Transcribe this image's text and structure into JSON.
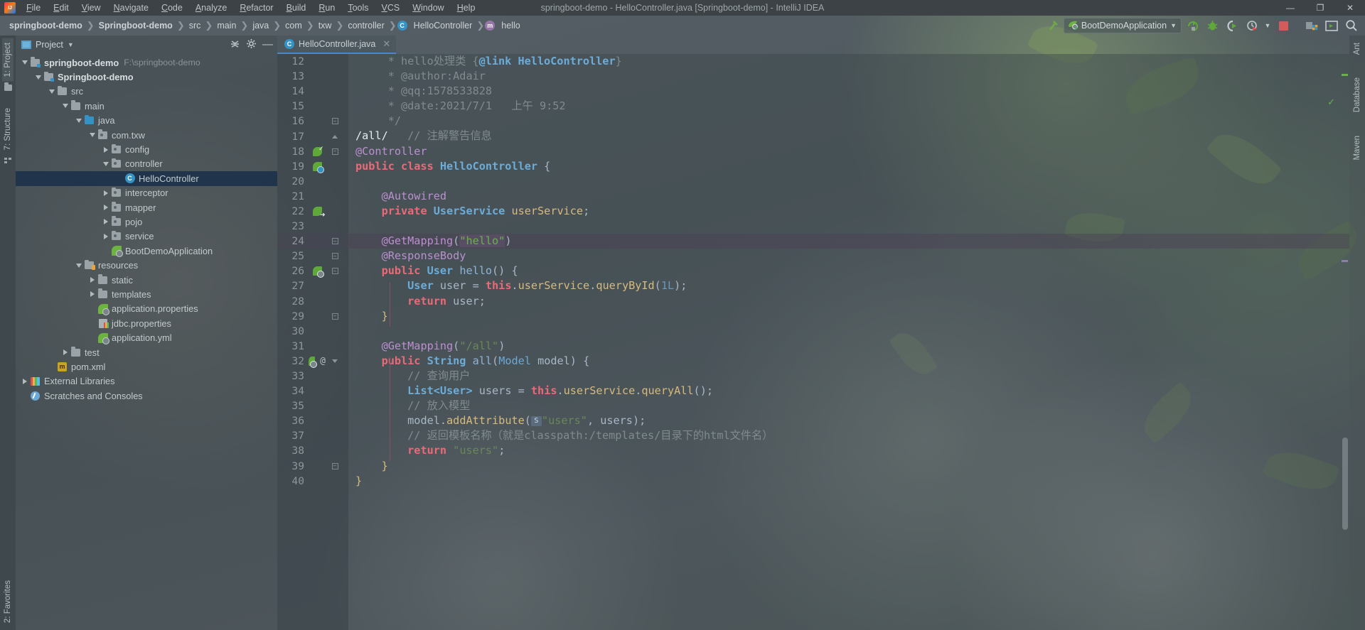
{
  "window": {
    "title": "springboot-demo - HelloController.java [Springboot-demo] - IntelliJ IDEA",
    "logo_icon": "intellij-idea-logo",
    "minimize_label": "—",
    "maximize_label": "❐",
    "close_label": "✕"
  },
  "menu": [
    {
      "label": "File"
    },
    {
      "label": "Edit"
    },
    {
      "label": "View"
    },
    {
      "label": "Navigate"
    },
    {
      "label": "Code"
    },
    {
      "label": "Analyze"
    },
    {
      "label": "Refactor"
    },
    {
      "label": "Build"
    },
    {
      "label": "Run"
    },
    {
      "label": "Tools"
    },
    {
      "label": "VCS"
    },
    {
      "label": "Window"
    },
    {
      "label": "Help"
    }
  ],
  "breadcrumb": [
    {
      "label": "springboot-demo",
      "bold": true
    },
    {
      "label": "Springboot-demo",
      "bold": true
    },
    {
      "label": "src"
    },
    {
      "label": "main"
    },
    {
      "label": "java"
    },
    {
      "label": "com"
    },
    {
      "label": "txw"
    },
    {
      "label": "controller"
    },
    {
      "label": "HelloController",
      "badge": "C"
    },
    {
      "label": "hello",
      "badge": "m"
    }
  ],
  "toolbar": {
    "run_config_name": "BootDemoApplication",
    "run_config_icon": "spring-boot-icon",
    "dropdown_icon": "chevron-down-icon",
    "build_icon": "build-hammer-icon",
    "icons": [
      {
        "name": "rerun-icon",
        "glyph": "↻"
      },
      {
        "name": "debug-icon",
        "glyph": "🐞"
      },
      {
        "name": "run-with-coverage-icon",
        "glyph": "▶"
      },
      {
        "name": "profiler-icon",
        "glyph": "⏱"
      },
      {
        "name": "profiler-dropdown-icon",
        "glyph": "▾"
      },
      {
        "name": "stop-icon",
        "glyph": "■"
      },
      {
        "name": "project-structure-icon",
        "glyph": "▤"
      },
      {
        "name": "terminal-icon",
        "glyph": "▶"
      },
      {
        "name": "search-everywhere-icon",
        "glyph": "🔍"
      }
    ]
  },
  "left_strip": {
    "project_tab": "1: Project",
    "structure_tab": "7: Structure",
    "favorites_tab": "2: Favorites"
  },
  "right_strip": {
    "ant_tab": "Ant",
    "database_tab": "Database",
    "maven_tab": "Maven"
  },
  "project_panel": {
    "title": "Project",
    "title_dropdown_icon": "chevron-down-icon",
    "collapse_all_icon": "collapse-all-icon",
    "settings_icon": "gear-icon",
    "hide_icon": "minimize-icon",
    "tree": [
      {
        "label": "springboot-demo",
        "path": "F:\\springboot-demo",
        "depth": 0,
        "twisty": "down",
        "icon": "module-folder",
        "bold": true
      },
      {
        "label": "Springboot-demo",
        "depth": 1,
        "twisty": "down",
        "icon": "module-folder",
        "bold": true
      },
      {
        "label": "src",
        "depth": 2,
        "twisty": "down",
        "icon": "folder"
      },
      {
        "label": "main",
        "depth": 3,
        "twisty": "down",
        "icon": "folder"
      },
      {
        "label": "java",
        "depth": 4,
        "twisty": "down",
        "icon": "source-folder"
      },
      {
        "label": "com.txw",
        "depth": 5,
        "twisty": "down",
        "icon": "package"
      },
      {
        "label": "config",
        "depth": 6,
        "twisty": "right",
        "icon": "package"
      },
      {
        "label": "controller",
        "depth": 6,
        "twisty": "down",
        "icon": "package"
      },
      {
        "label": "HelloController",
        "depth": 7,
        "twisty": "none",
        "icon": "java-class",
        "selected": true
      },
      {
        "label": "interceptor",
        "depth": 6,
        "twisty": "right",
        "icon": "package"
      },
      {
        "label": "mapper",
        "depth": 6,
        "twisty": "right",
        "icon": "package"
      },
      {
        "label": "pojo",
        "depth": 6,
        "twisty": "right",
        "icon": "package"
      },
      {
        "label": "service",
        "depth": 6,
        "twisty": "right",
        "icon": "package"
      },
      {
        "label": "BootDemoApplication",
        "depth": 6,
        "twisty": "none",
        "icon": "spring-boot-class"
      },
      {
        "label": "resources",
        "depth": 4,
        "twisty": "down",
        "icon": "resources-folder"
      },
      {
        "label": "static",
        "depth": 5,
        "twisty": "right",
        "icon": "folder"
      },
      {
        "label": "templates",
        "depth": 5,
        "twisty": "right",
        "icon": "folder"
      },
      {
        "label": "application.properties",
        "depth": 5,
        "twisty": "none",
        "icon": "spring-config"
      },
      {
        "label": "jdbc.properties",
        "depth": 5,
        "twisty": "none",
        "icon": "properties-file"
      },
      {
        "label": "application.yml",
        "depth": 5,
        "twisty": "none",
        "icon": "spring-config"
      },
      {
        "label": "test",
        "depth": 3,
        "twisty": "right",
        "icon": "folder"
      },
      {
        "label": "pom.xml",
        "depth": 2,
        "twisty": "none",
        "icon": "maven-file"
      },
      {
        "label": "External Libraries",
        "depth": 0,
        "twisty": "right",
        "icon": "libraries"
      },
      {
        "label": "Scratches and Consoles",
        "depth": 0,
        "twisty": "none",
        "icon": "scratches"
      }
    ]
  },
  "editor": {
    "tab": {
      "label": "HelloController.java",
      "icon": "java-class",
      "close_icon": "close-icon"
    },
    "inspection_status_icon": "inspection-ok-icon",
    "first_line": 12,
    "lines": [
      {
        "n": 12,
        "gutter": "",
        "fold": "",
        "html": "<span class='cmt'>     * hello处理类 {</span><span class='cls-blue'>@link HelloController</span><span class='cmt'>}</span>"
      },
      {
        "n": 13,
        "gutter": "",
        "fold": "",
        "html": "<span class='cmt'>     * @author:Adair</span>"
      },
      {
        "n": 14,
        "gutter": "",
        "fold": "",
        "html": "<span class='cmt'>     * @qq:1578533828</span>"
      },
      {
        "n": 15,
        "gutter": "",
        "fold": "",
        "html": "<span class='cmt'>     * @date:2021/7/1</span><span class='cmt'>   上午 9:52</span>"
      },
      {
        "n": 16,
        "gutter": "",
        "fold": "fold-end",
        "html": "<span class='cmt'>     */</span>"
      },
      {
        "n": 17,
        "gutter": "",
        "fold": "fold-tri-u",
        "html": "<span class='white'>/all/</span><span class='cmt'>   // 注解警告信息</span>"
      },
      {
        "n": 18,
        "gutter": "spring-check",
        "fold": "fold-minus",
        "html": "<span class='ann'>@Controller</span>"
      },
      {
        "n": 19,
        "gutter": "spring-bean",
        "fold": "",
        "html": "<span class='kw-pink'>public class </span><span class='cls-blue'>HelloController</span><span class='par'> {</span>"
      },
      {
        "n": 20,
        "gutter": "",
        "fold": "",
        "html": ""
      },
      {
        "n": 21,
        "gutter": "",
        "fold": "",
        "html": "    <span class='ann'>@Autowired</span>"
      },
      {
        "n": 22,
        "gutter": "spring-arrow",
        "fold": "",
        "html": "    <span class='kw-pink'>private </span><span class='cls-blue'>UserService </span><span class='fld2'>userService</span><span class='par'>;</span>"
      },
      {
        "n": 23,
        "gutter": "",
        "fold": "",
        "html": ""
      },
      {
        "n": 24,
        "gutter": "",
        "fold": "fold-minus",
        "highlight": true,
        "html": "    <span class='ann'>@GetMapping</span><span class='par'>(</span><span class='str-hl'>\"hello\"</span><span class='par'>)</span>"
      },
      {
        "n": 25,
        "gutter": "",
        "fold": "fold-minus",
        "html": "    <span class='ann'>@ResponseBody</span>"
      },
      {
        "n": 26,
        "gutter": "spring-gear",
        "fold": "fold-minus",
        "html": "    <span class='kw-pink'>public </span><span class='cls-blue'>User </span><span class='mth'>hello</span><span class='par'>() {</span>"
      },
      {
        "n": 27,
        "gutter": "",
        "fold": "",
        "html": "        <span class='cls-blue'>User </span><span class='par'>user = </span><span class='kw-pink'>this</span><span class='par'>.</span><span class='fld2'>userService</span><span class='par'>.</span><span class='fld2'>queryById</span><span class='par'>(</span><span class='num'>1L</span><span class='par'>);</span>"
      },
      {
        "n": 28,
        "gutter": "",
        "fold": "",
        "html": "        <span class='kw-pink'>return </span><span class='par'>user;</span>"
      },
      {
        "n": 29,
        "gutter": "",
        "fold": "fold-end",
        "html": "    <span class='fld2'>}</span>"
      },
      {
        "n": 30,
        "gutter": "",
        "fold": "",
        "html": ""
      },
      {
        "n": 31,
        "gutter": "",
        "fold": "",
        "html": "    <span class='ann'>@GetMapping</span><span class='par'>(</span><span class='str'>\"/all\"</span><span class='par'>)</span>"
      },
      {
        "n": 32,
        "gutter": "spring-gear-at",
        "fold": "fold-tri-d",
        "html": "    <span class='kw-pink'>public </span><span class='cls-blue'>String </span><span class='mth'>all</span><span class='par'>(</span><span class='typ'>Model </span><span class='par'>model) {</span>"
      },
      {
        "n": 33,
        "gutter": "",
        "fold": "",
        "html": "        <span class='cmt'>// 查询用户</span>"
      },
      {
        "n": 34,
        "gutter": "",
        "fold": "",
        "html": "        <span class='cls-blue'>List&lt;User&gt; </span><span class='par'>users = </span><span class='kw-pink'>this</span><span class='par'>.</span><span class='fld2'>userService</span><span class='par'>.</span><span class='fld2'>queryAll</span><span class='par'>();</span>"
      },
      {
        "n": 35,
        "gutter": "",
        "fold": "",
        "html": "        <span class='cmt'>// 放入模型</span>"
      },
      {
        "n": 36,
        "gutter": "",
        "fold": "",
        "html": "        <span class='par'>model.</span><span class='fld2'>addAttribute</span><span class='par'>(</span><span class='sicon'>S</span><span class='str'>\"users\"</span><span class='par'>, users);</span>"
      },
      {
        "n": 37,
        "gutter": "",
        "fold": "",
        "html": "        <span class='cmt'>// 返回模板名称（就是classpath:/templates/目录下的html文件名）</span>"
      },
      {
        "n": 38,
        "gutter": "",
        "fold": "",
        "html": "        <span class='kw-pink'>return </span><span class='str'>\"users\"</span><span class='par'>;</span>"
      },
      {
        "n": 39,
        "gutter": "",
        "fold": "fold-end",
        "html": "    <span class='fld2'>}</span>"
      },
      {
        "n": 40,
        "gutter": "",
        "fold": "",
        "html": "<span class='fld2'>}</span>"
      }
    ]
  }
}
